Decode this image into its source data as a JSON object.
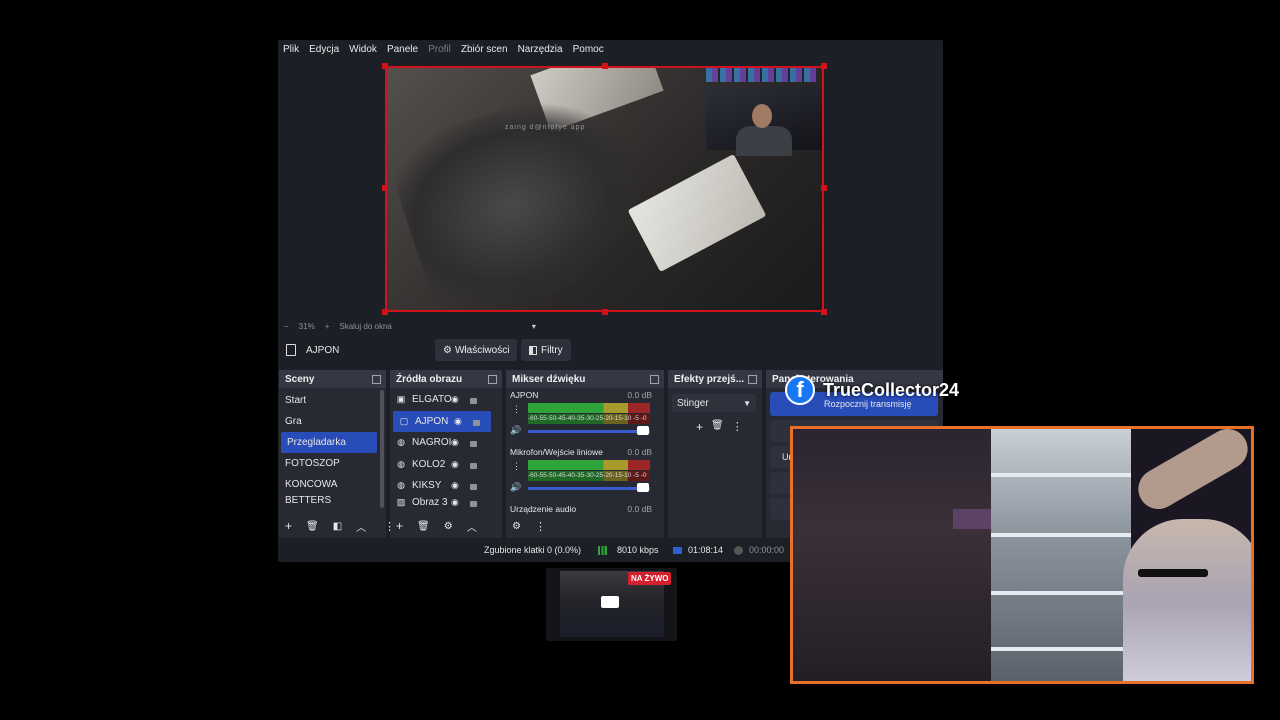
{
  "obs": {
    "menu": [
      {
        "label": "Plik",
        "dim": false
      },
      {
        "label": "Edycja",
        "dim": false
      },
      {
        "label": "Widok",
        "dim": false
      },
      {
        "label": "Panele",
        "dim": false
      },
      {
        "label": "Profil",
        "dim": true
      },
      {
        "label": "Zbiór scen",
        "dim": false
      },
      {
        "label": "Narzędzia",
        "dim": false
      },
      {
        "label": "Pomoc",
        "dim": false
      }
    ],
    "preview": {
      "watermark": "zaing d@nfofye app"
    },
    "zoom": {
      "minus": "−",
      "value": "31%",
      "plus": "+",
      "mode": "Skaluj do okna",
      "caret": "▾"
    },
    "source_bar": {
      "name": "AJPON",
      "properties": "Właściwości",
      "filters": "Filtry"
    },
    "scenes": {
      "title": "Sceny",
      "items": [
        {
          "label": "Start",
          "selected": false
        },
        {
          "label": "Gra",
          "selected": false
        },
        {
          "label": "Przegladarka",
          "selected": true
        },
        {
          "label": "FOTOSZOP",
          "selected": false
        },
        {
          "label": "KONCOWA",
          "selected": false
        },
        {
          "label": "BETTERS",
          "selected": false
        }
      ]
    },
    "sources": {
      "title": "Źródła obrazu",
      "items": [
        {
          "label": "ELGATO",
          "icon": "camera-icon",
          "selected": false
        },
        {
          "label": "AJPON",
          "icon": "doc-icon",
          "selected": true
        },
        {
          "label": "NAGROI",
          "icon": "globe-icon",
          "selected": false
        },
        {
          "label": "KOLO2",
          "icon": "globe-icon",
          "selected": false
        },
        {
          "label": "KIKSY",
          "icon": "globe-icon",
          "selected": false
        },
        {
          "label": "Obraz 3",
          "icon": "image-icon",
          "selected": false
        }
      ]
    },
    "mixer": {
      "title": "Mikser dźwięku",
      "scale": "-60-55-50-45-40-35-30-25-20-15-10 -5 -0",
      "channels": [
        {
          "name": "AJPON",
          "db": "0.0 dB"
        },
        {
          "name": "Mikrofon/Wejście liniowe",
          "db": "0.0 dB"
        },
        {
          "name": "Urządzenie audio",
          "db": "0.0 dB"
        }
      ]
    },
    "transitions": {
      "title": "Efekty przejś...",
      "selected": "Stinger"
    },
    "controls": {
      "title": "Panel sterowania",
      "start_stream": "Rozpocznij transmisję",
      "partial": "Ur"
    },
    "status": {
      "dropped": "Zgubione klatki 0 (0.0%)",
      "bitrate": "8010 kbps",
      "live_time": "01:08:14",
      "rec_time": "00:00:00"
    },
    "colors": {
      "accent": "#284cb8",
      "selection_border": "#d1121b",
      "panel": "#272a33",
      "header": "#353844"
    }
  },
  "overlay": {
    "facebook_name": "TrueCollector24",
    "facebook_icon": "facebook-icon",
    "live_badge": "NA ŻYWO",
    "border_color": "#e8712a"
  }
}
